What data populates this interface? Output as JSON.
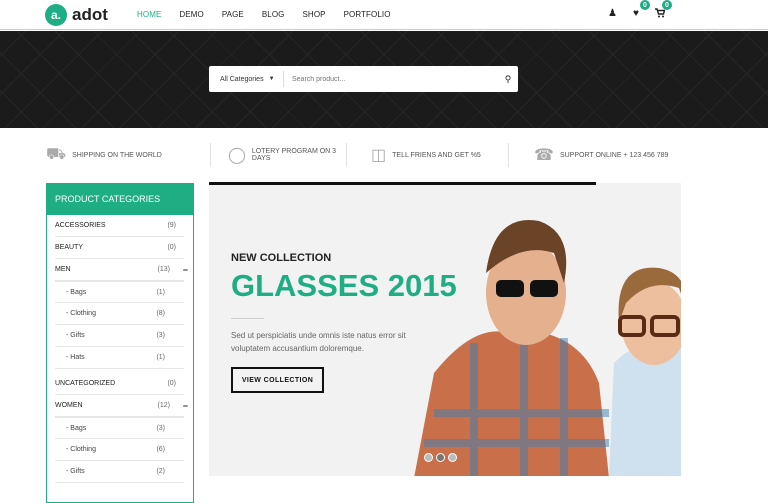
{
  "header": {
    "logo_mark": "a.",
    "logo_text": "adot",
    "nav": [
      "HOME",
      "DEMO",
      "PAGE",
      "BLOG",
      "SHOP",
      "PORTFOLIO"
    ],
    "active": "HOME",
    "wishlist_count": "0",
    "cart_count": "0"
  },
  "search": {
    "category": "All Categories",
    "placeholder": "Search product..."
  },
  "features": [
    "SHIPPING ON THE WORLD",
    "LOTERY PROGRAM ON 3 DAYS",
    "TELL FRIENS AND GET %5",
    "SUPPORT ONLINE + 123 456 789"
  ],
  "sidebar": {
    "title": "PRODUCT CATEGORIES",
    "items": [
      {
        "label": "ACCESSORIES",
        "count": "(9)"
      },
      {
        "label": "BEAUTY",
        "count": "(0)"
      },
      {
        "label": "MEN",
        "count": "(13)",
        "toggle": "−"
      },
      {
        "label": "- Bags",
        "count": "(1)"
      },
      {
        "label": "- Clothing",
        "count": "(8)"
      },
      {
        "label": "- Gifts",
        "count": "(3)"
      },
      {
        "label": "- Hats",
        "count": "(1)"
      },
      {
        "label": "UNCATEGORIZED",
        "count": "(0)"
      },
      {
        "label": "WOMEN",
        "count": "(12)",
        "toggle": "−"
      },
      {
        "label": "- Bags",
        "count": "(3)"
      },
      {
        "label": "- Clothing",
        "count": "(6)"
      },
      {
        "label": "- Gifts",
        "count": "(2)"
      }
    ]
  },
  "slider": {
    "kicker": "NEW COLLECTION",
    "title": "GLASSES 2015",
    "description": "Sed ut perspiciatis unde omnis iste natus error sit voluptatem accusantium doloremque.",
    "button": "VIEW COLLECTION",
    "progress_percent": 82,
    "slide_count": 3,
    "active_slide": 2
  },
  "colors": {
    "accent": "#1fad84",
    "dark": "#1b1b1b"
  }
}
